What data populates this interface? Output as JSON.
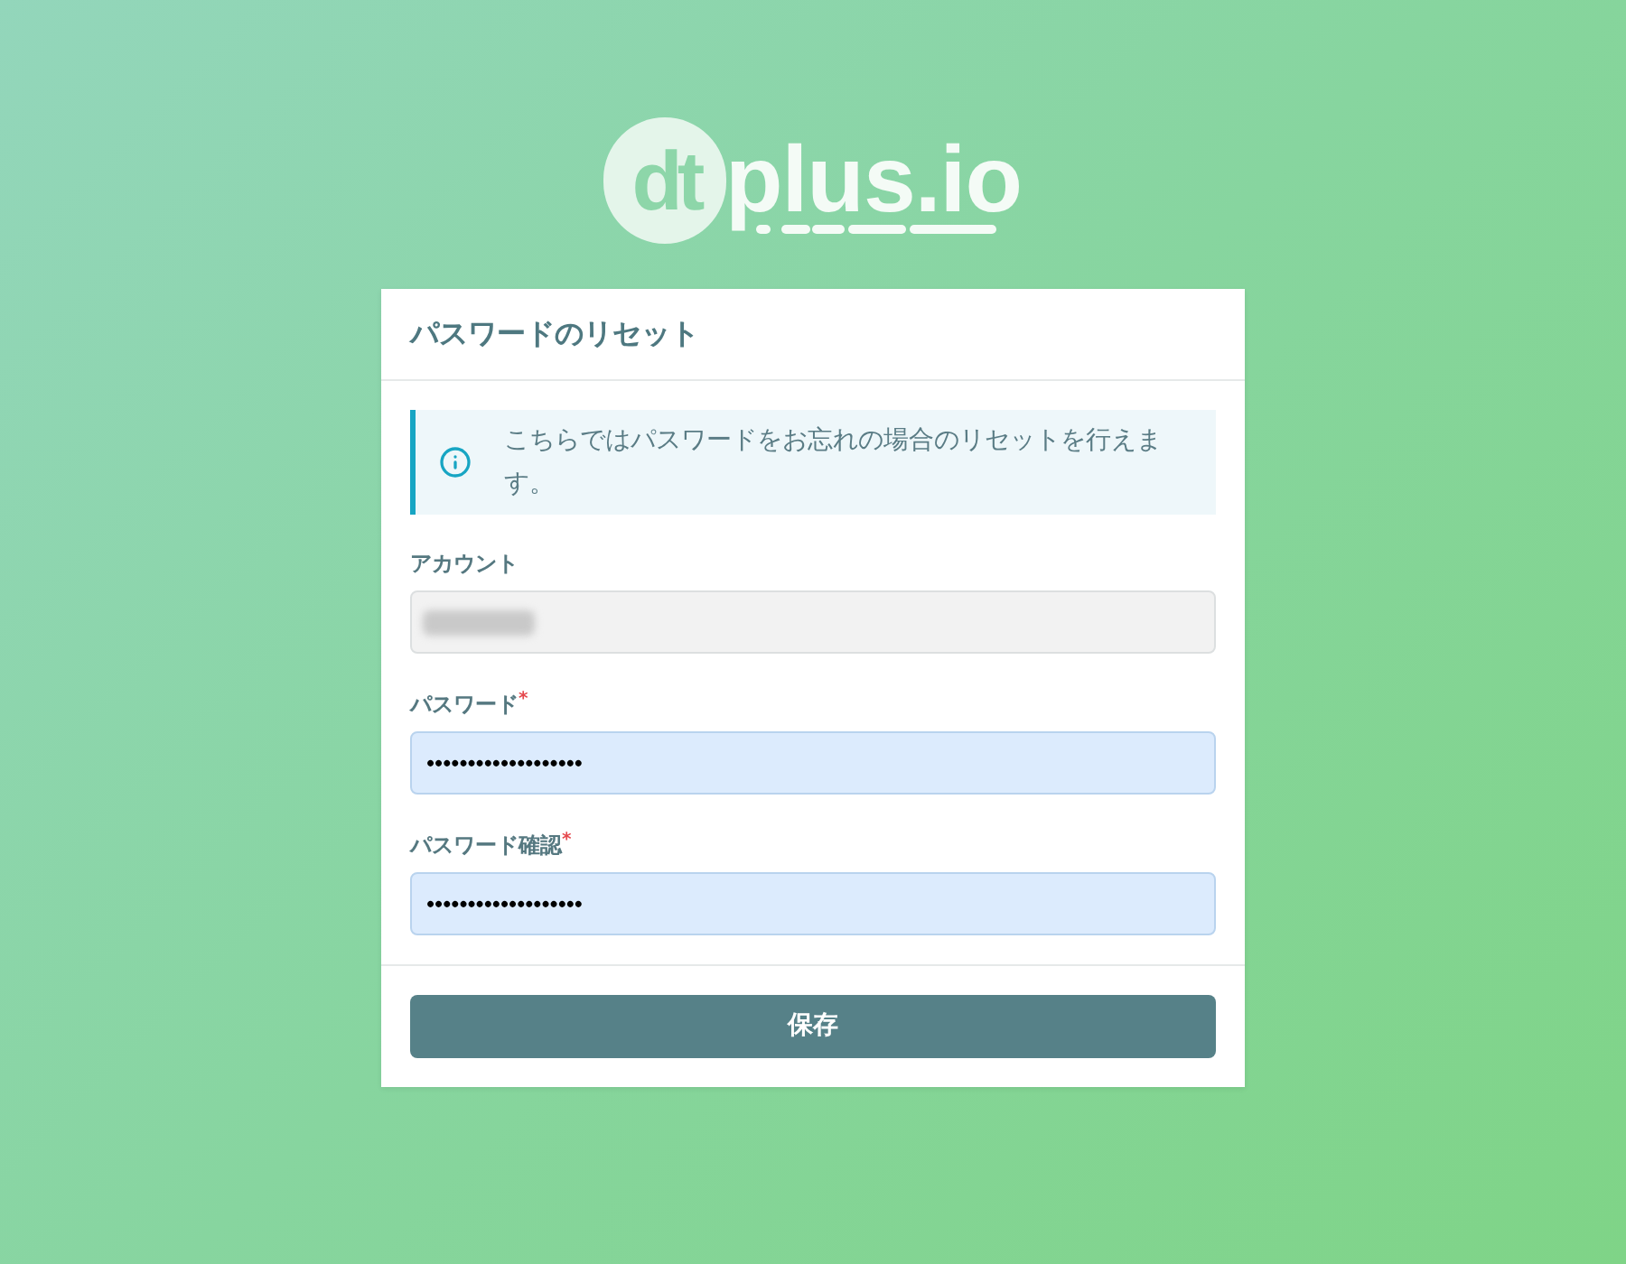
{
  "logo": {
    "mark": "dt",
    "text": "plus.io"
  },
  "card": {
    "title": "パスワードのリセット",
    "notice": {
      "text": "こちらではパスワードをお忘れの場合のリセットを行えます。"
    },
    "fields": [
      {
        "label": "アカウント",
        "disabled": true,
        "redacted": true
      },
      {
        "label": "パスワード",
        "required_mark": "*",
        "value": "•••••••••••••••••••",
        "autofilled": true
      },
      {
        "label": "パスワード確認",
        "required_mark": "*",
        "value": "•••••••••••••••••••",
        "autofilled": true
      }
    ],
    "button": {
      "label": "保存"
    }
  }
}
